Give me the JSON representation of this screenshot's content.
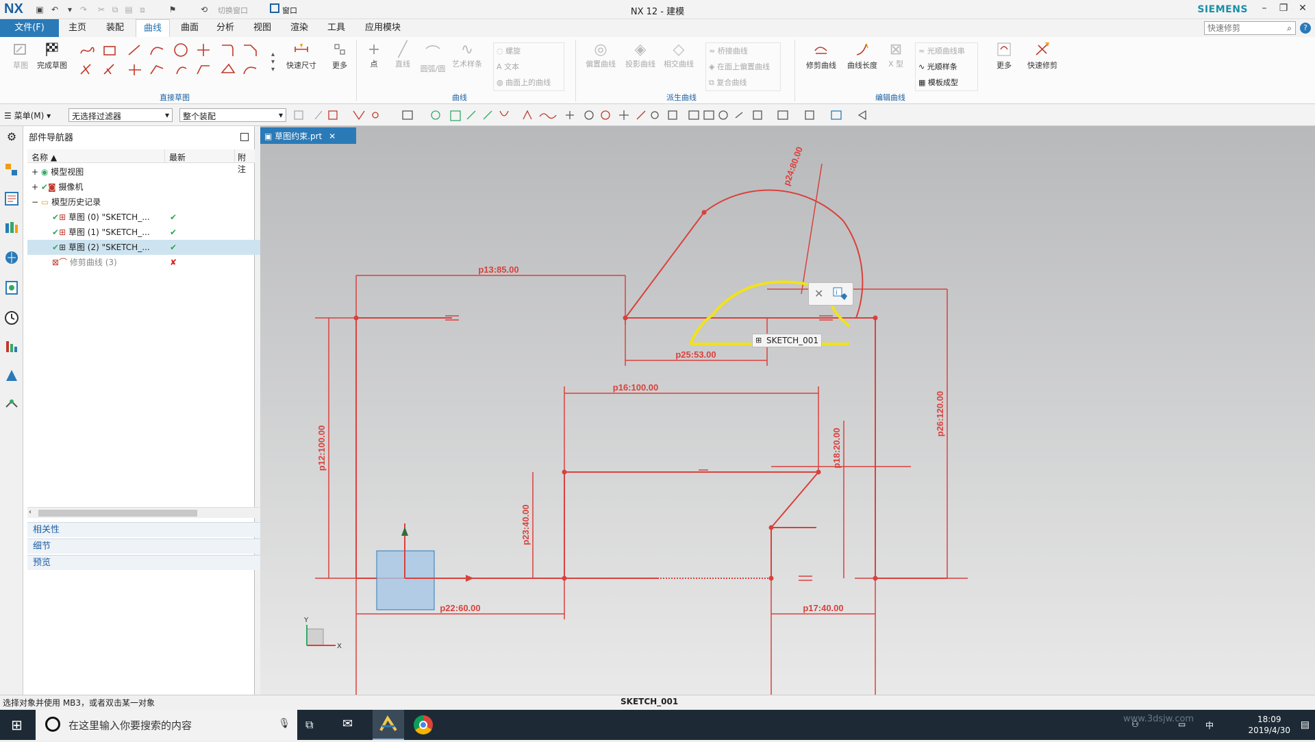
{
  "window": {
    "app_logo": "NX",
    "title": "NX 12 - 建模",
    "brand": "SIEMENS",
    "quick_access_switch": "切换窗口",
    "quick_access_window": "窗口"
  },
  "menu_tabs": {
    "file": "文件(F)",
    "items": [
      "主页",
      "装配",
      "曲线",
      "曲面",
      "分析",
      "视图",
      "渲染",
      "工具",
      "应用模块"
    ],
    "active": "曲线",
    "search_placeholder": "快速修剪"
  },
  "ribbon": {
    "sketch_label": "草图",
    "finish_sketch_label": "完成草图",
    "direct_sketch_group": "直接草图",
    "rapid_dimension": "快速尺寸",
    "more": "更多",
    "point": "点",
    "line": "直线",
    "arc_circle": "圆弧/圆",
    "artistic_spline": "艺术样条",
    "helix": "螺旋",
    "text": "文本",
    "curve_on_surface": "曲面上的曲线",
    "curve_group": "曲线",
    "offset_curve": "偏置曲线",
    "projected_curve": "投影曲线",
    "intersection_curve": "相交曲线",
    "bridge_curve": "桥接曲线",
    "offset_on_face": "在面上偏置曲线",
    "composite_curve": "复合曲线",
    "derived_group": "派生曲线",
    "trim_curve": "修剪曲线",
    "curve_length": "曲线长度",
    "x_type": "X 型",
    "smooth_spline_string": "光顺曲线串",
    "smooth_spline": "光顺样条",
    "template_shape": "模板成型",
    "edit_group": "编辑曲线",
    "more2": "更多",
    "quick_trim": "快速修剪"
  },
  "toolbar2": {
    "menu": "菜单(M)",
    "filter": "无选择过滤器",
    "scope": "整个装配"
  },
  "navigator": {
    "title": "部件导航器",
    "col_name": "名称",
    "col_latest": "最新",
    "col_note": "附注",
    "rows": [
      {
        "label": "模型视图",
        "latest": ""
      },
      {
        "label": "摄像机",
        "latest": ""
      },
      {
        "label": "模型历史记录",
        "latest": ""
      },
      {
        "label": "草图 (0) \"SKETCH_...",
        "latest": "✔"
      },
      {
        "label": "草图 (1) \"SKETCH_...",
        "latest": "✔"
      },
      {
        "label": "草图 (2) \"SKETCH_...",
        "latest": "✔"
      },
      {
        "label": "修剪曲线 (3)",
        "latest": "✘"
      }
    ],
    "panels": [
      "相关性",
      "细节",
      "预览"
    ]
  },
  "document_tab": "草图约束.prt",
  "sketch": {
    "dimensions": [
      "p13:85.00",
      "p25:53.00",
      "p24:80.00",
      "p16:100.00",
      "p12:100.00",
      "p23:40.00",
      "p18:20.00",
      "p26:120.00",
      "p22:60.00",
      "p17:40.00"
    ],
    "tooltip": "SKETCH_001",
    "axis_x": "X",
    "axis_y": "Y"
  },
  "colors": {
    "sketch": "#d9413c",
    "highlight": "#f2e21a",
    "accent": "#2a7ab8"
  },
  "status": {
    "prompt": "选择对象并使用 MB3，或者双击某一对象",
    "center": "SKETCH_001"
  },
  "taskbar": {
    "search_placeholder": "在这里输入你要搜索的内容",
    "time": "18:09",
    "date": "2019/4/30",
    "watermark": "www.3dsjw.com"
  }
}
